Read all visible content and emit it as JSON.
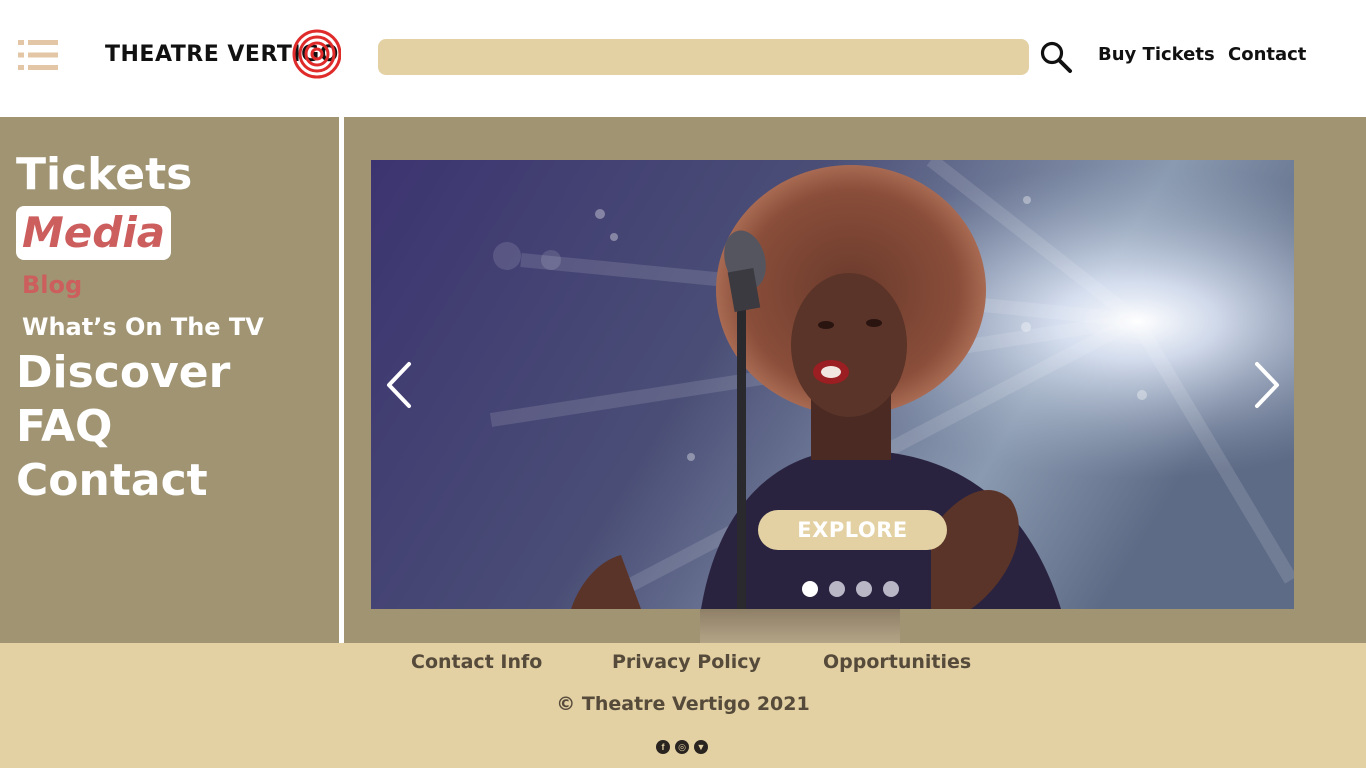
{
  "header": {
    "logo_text": "THEATRE VERTIGO",
    "search": {
      "value": "",
      "placeholder": ""
    },
    "nav": {
      "buy_tickets": "Buy Tickets",
      "contact": "Contact"
    }
  },
  "sidebar": {
    "items": [
      {
        "label": "Tickets"
      },
      {
        "label": "Media",
        "active": true
      },
      {
        "label": "Blog",
        "sub": true,
        "highlighted": true
      },
      {
        "label": "What’s On The TV",
        "sub": true
      },
      {
        "label": "Discover"
      },
      {
        "label": "FAQ"
      },
      {
        "label": "Contact"
      }
    ]
  },
  "carousel": {
    "explore_label": "EXPLORE",
    "slide_count": 4,
    "active_slide": 1,
    "image_subject": "singer-at-microphone"
  },
  "footer": {
    "links": {
      "contact_info": "Contact Info",
      "privacy_policy": "Privacy Policy",
      "opportunities": "Opportunities"
    },
    "copyright": "© Theatre Vertigo 2021",
    "social": [
      "facebook-icon",
      "instagram-icon",
      "twitter-icon"
    ]
  },
  "colors": {
    "accent_tan": "#e3d1a4",
    "sidebar_bg": "#a09473",
    "highlight_red": "#cc5e5e",
    "footer_text": "#564b3b"
  }
}
